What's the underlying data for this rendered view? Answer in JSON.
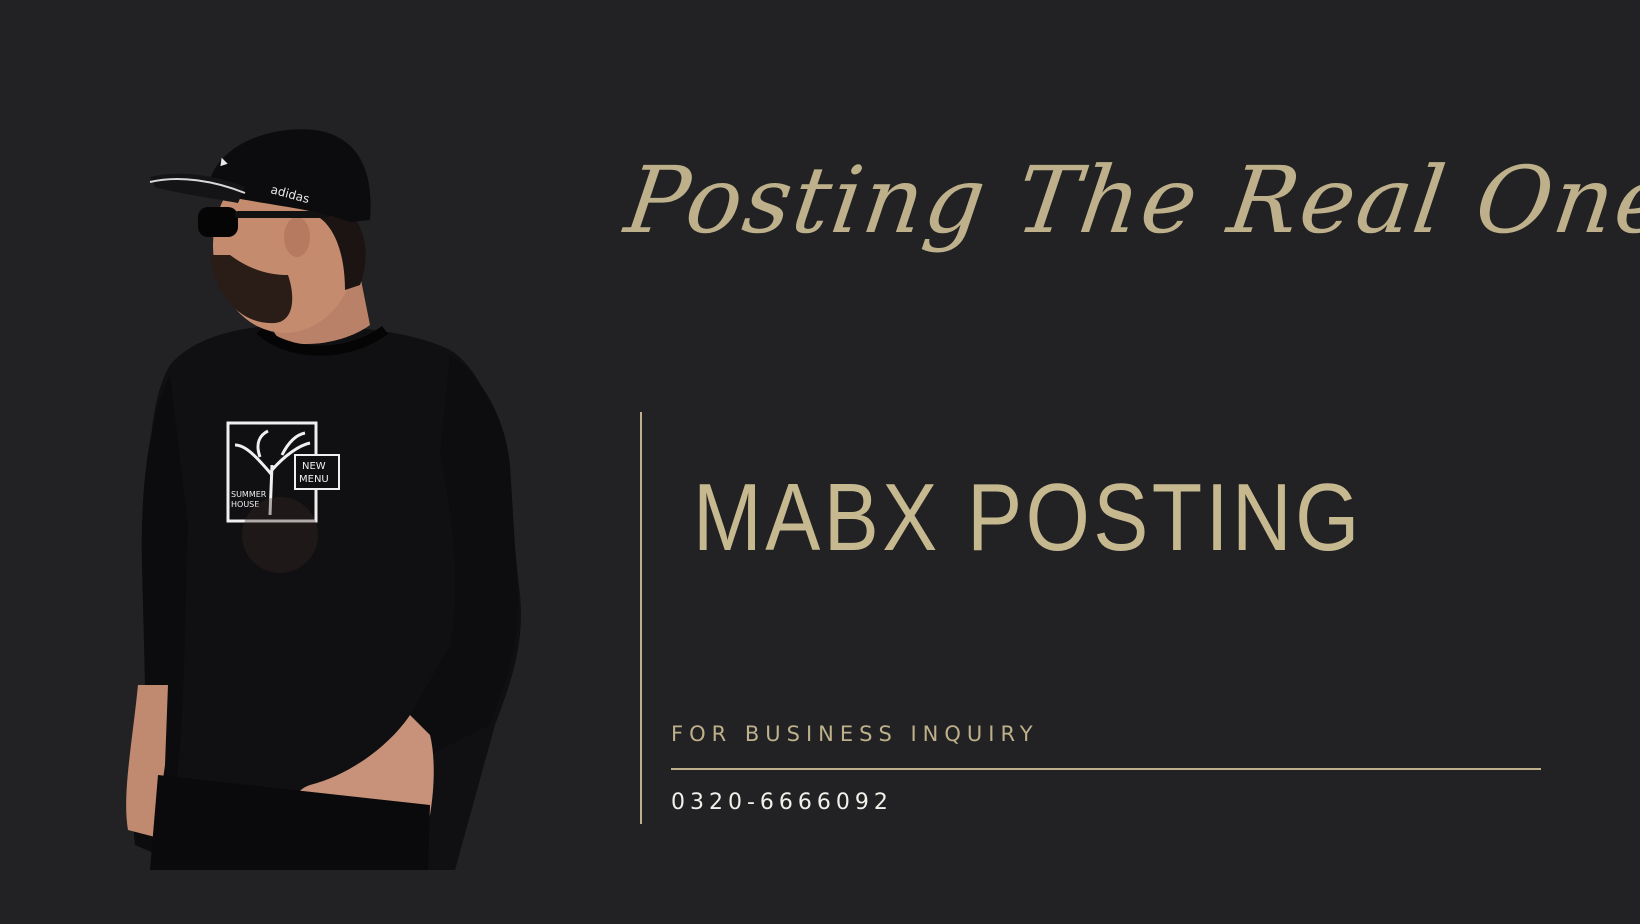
{
  "poster": {
    "script_title": "Posting The Real One",
    "brand_name": "MABX POSTING",
    "inquiry_label": "FOR BUSINESS INQUIRY",
    "phone": "0320-6666092"
  },
  "photo": {
    "cap_text": "adidas",
    "shirt_tag": "NEW MENU",
    "shirt_label": "SUMMER HOUSE"
  },
  "colors": {
    "background": "#222224",
    "accent_gold": "#bdb08a",
    "phone_text": "#f2f0ea"
  }
}
